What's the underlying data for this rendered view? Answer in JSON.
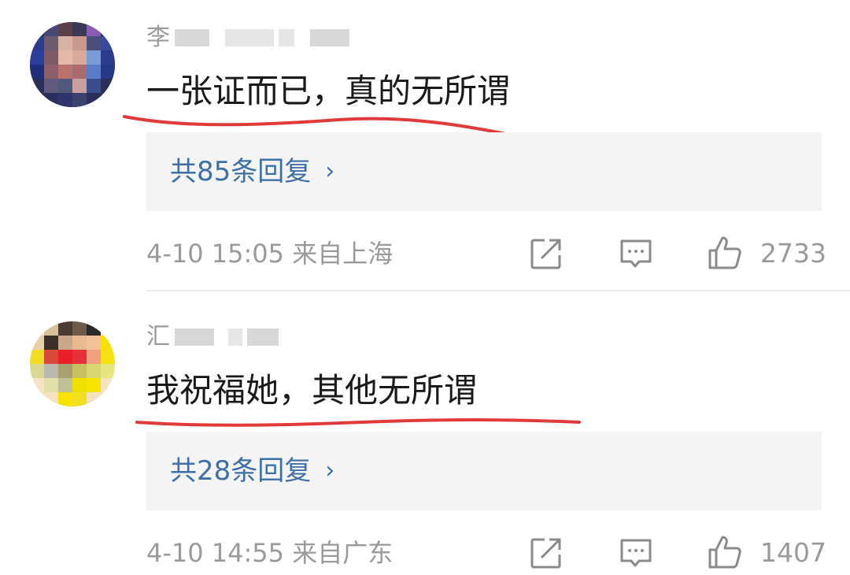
{
  "comments": [
    {
      "username_first_char": "李",
      "text": "一张证而已，真的无所谓",
      "replies_label": "共85条回复",
      "chevron": "›",
      "meta": "4-10 15:05 来自上海",
      "likes": "2733",
      "icons": [
        "share-icon",
        "comment-icon",
        "like-icon"
      ],
      "annotation_color": "#e03a3a"
    },
    {
      "username_first_char": "汇",
      "text": "我祝福她，其他无所谓",
      "replies_label": "共28条回复",
      "chevron": "›",
      "meta": "4-10 14:55 来自广东",
      "likes": "1407",
      "icons": [
        "share-icon",
        "comment-icon",
        "like-icon"
      ],
      "annotation_color": "#e03a3a"
    }
  ]
}
